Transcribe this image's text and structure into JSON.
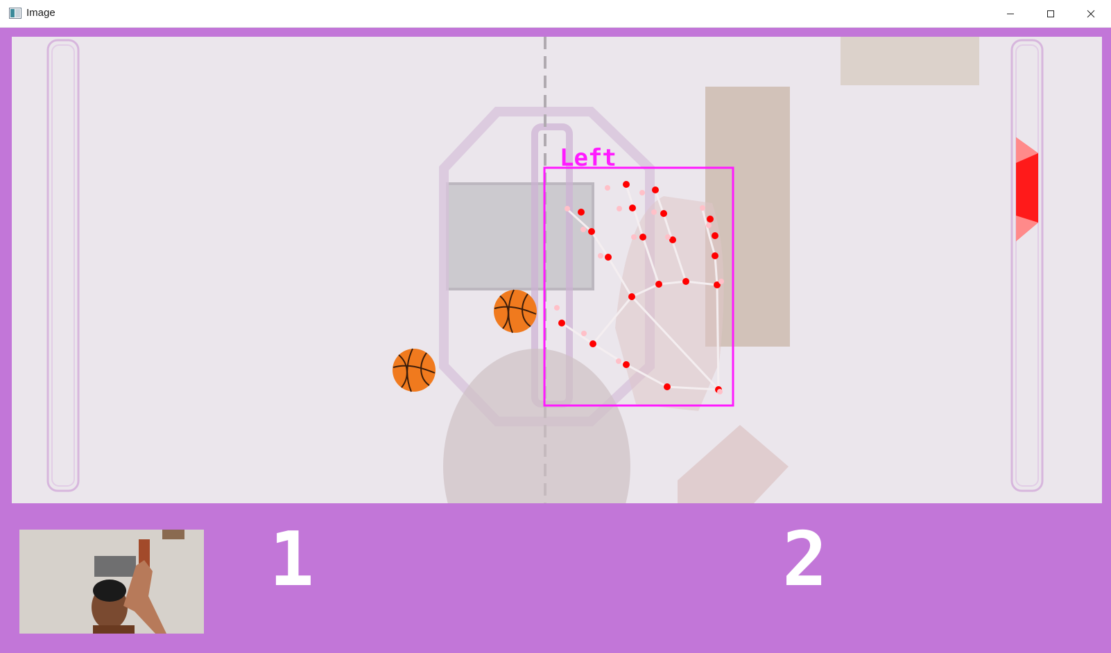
{
  "window": {
    "title": "Image",
    "icon": "image-window-icon",
    "controls": [
      "minimize-icon",
      "maximize-icon",
      "close-icon"
    ]
  },
  "game": {
    "hand_label": "Left",
    "score_left": "1",
    "score_right": "2",
    "balls": 2,
    "colors": {
      "frame": "#c276d8",
      "court": "#ebe6ec",
      "hand_box": "#ff1aff",
      "landmark": "#ff0000",
      "paddle_right": "#ff1a1a",
      "ball": "#f07a1e"
    }
  }
}
